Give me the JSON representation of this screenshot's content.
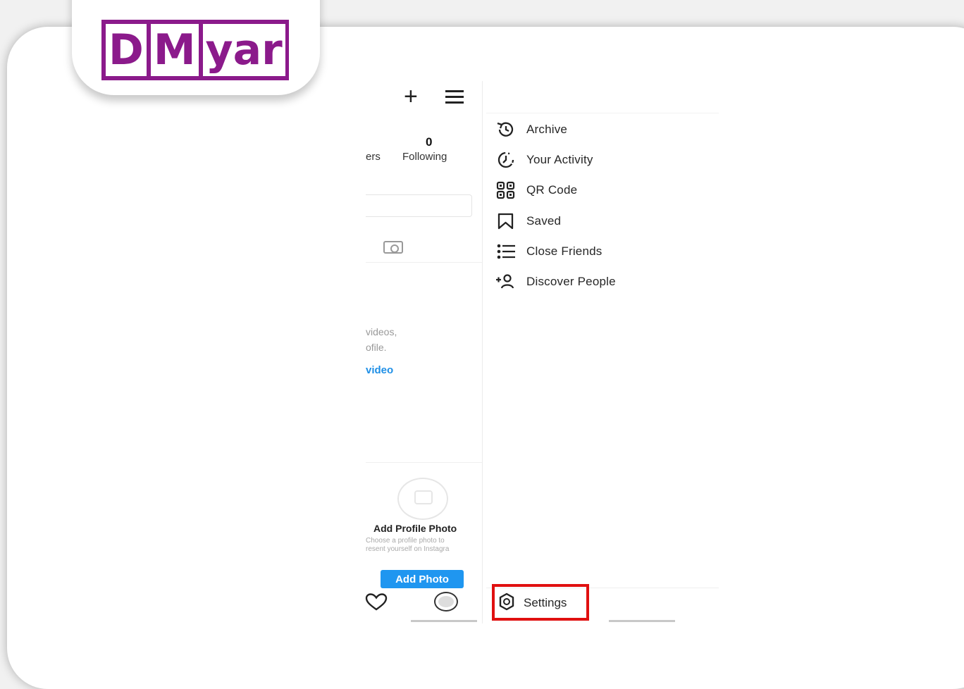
{
  "logo": {
    "letters": [
      "D",
      "M",
      "yar"
    ]
  },
  "profile": {
    "following_count": "0",
    "following_label": "Following",
    "followers_label_cut": "ers",
    "empty_line1": "videos,",
    "empty_line2": "ofile.",
    "share_link": "video",
    "add_profile_title": "Add Profile Photo",
    "add_profile_sub1": "Choose a profile photo to",
    "add_profile_sub2": "resent yourself on Instagra",
    "add_photo_button": "Add Photo"
  },
  "menu": {
    "items": [
      {
        "label": "Archive",
        "icon": "archive-icon"
      },
      {
        "label": "Your Activity",
        "icon": "activity-icon"
      },
      {
        "label": "QR Code",
        "icon": "qr-code-icon"
      },
      {
        "label": "Saved",
        "icon": "bookmark-icon"
      },
      {
        "label": "Close Friends",
        "icon": "list-icon"
      },
      {
        "label": "Discover People",
        "icon": "add-person-icon"
      }
    ],
    "settings_label": "Settings",
    "settings_icon": "gear-icon"
  },
  "colors": {
    "logo": "#8b1a8b",
    "highlight": "#e01010",
    "button": "#1f96f0",
    "link": "#1f8fe6"
  }
}
